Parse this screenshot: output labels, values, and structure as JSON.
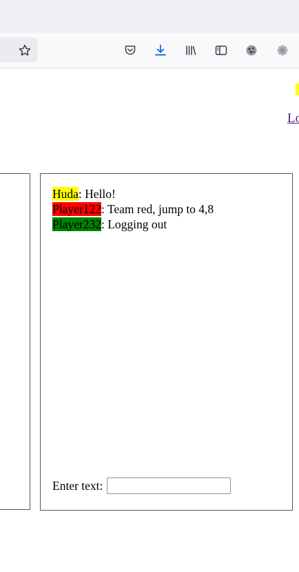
{
  "toolbar": {
    "icons": [
      "star-icon",
      "pocket-icon",
      "download-icon",
      "library-icon",
      "sidebar-icon",
      "extension-icon",
      "extension-icon-2"
    ],
    "download_color": "#0061e0"
  },
  "header": {
    "highlight_color": "#ffff00",
    "link_text": "Lo"
  },
  "chat": {
    "messages": [
      {
        "user": "Huda",
        "text": ": Hello!",
        "color": "#ffff00"
      },
      {
        "user": "Player122",
        "text": ": Team red, jump to 4,8",
        "color": "#ff0000"
      },
      {
        "user": "Player232",
        "text": ": Logging out",
        "color": "#008000"
      }
    ],
    "input_label": "Enter text:",
    "input_value": ""
  }
}
